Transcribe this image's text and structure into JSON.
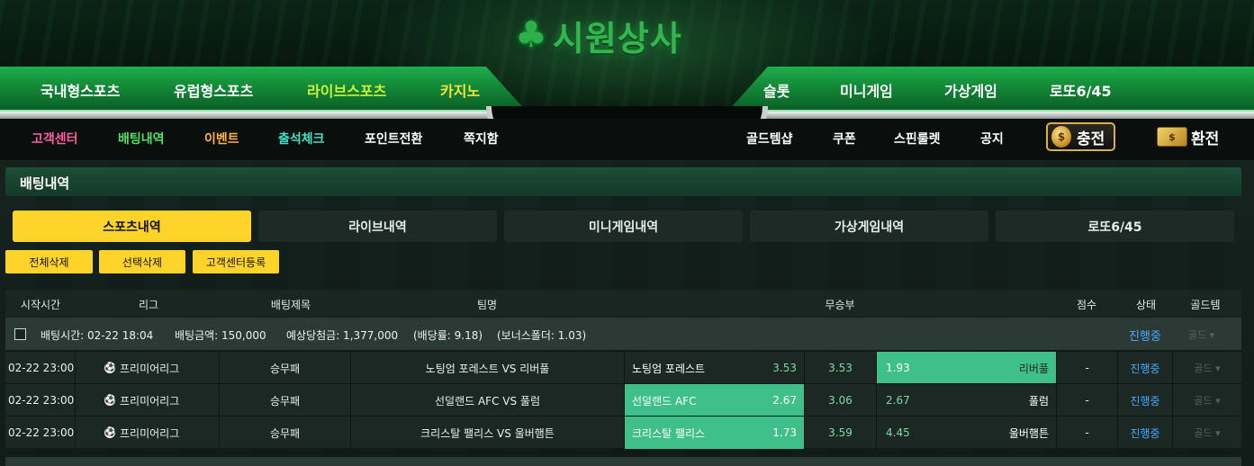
{
  "brand": {
    "logo_text": "시원상사",
    "logo_icon": "clover-icon"
  },
  "nav_main": {
    "left": [
      "국내형스포츠",
      "유럽형스포츠",
      "라이브스포츠",
      "카지노"
    ],
    "right": [
      "슬롯",
      "미니게임",
      "가상게임",
      "로또6/45"
    ]
  },
  "nav_sub": {
    "left": [
      "고객센터",
      "배팅내역",
      "이벤트",
      "출석체크",
      "포인트전환",
      "쪽지함"
    ],
    "right": [
      "골드템샵",
      "쿠폰",
      "스핀룰렛",
      "공지"
    ],
    "charge_label": "충전",
    "exchange_label": "환전"
  },
  "page": {
    "section_title": "배팅내역",
    "tabs": [
      "스포츠내역",
      "라이브내역",
      "미니게임내역",
      "가상게임내역",
      "로또6/45"
    ],
    "actions": [
      "전체삭제",
      "선택삭제",
      "고객센터등록"
    ]
  },
  "table": {
    "headers": [
      "시작시간",
      "리그",
      "배팅제목",
      "팀명",
      "무승부",
      "점수",
      "상태",
      "골드템"
    ],
    "summary": {
      "bet_time": "배팅시간:  02-22 18:04",
      "bet_amount": "배팅금액:  150,000",
      "expected": "예상당첨금:  1,377,000",
      "odds": "(배당률: 9.18)",
      "bonus": "(보너스폴더: 1.03)",
      "status": "진행중",
      "gold": "골드 ▾"
    },
    "rows": [
      {
        "time": "02-22 23:00",
        "league": "프리미어리그",
        "title": "승무패",
        "match": "노팅엄 포레스트 VS 리버풀",
        "home": "노팅엄 포레스트",
        "home_odds": "3.53",
        "draw": "3.53",
        "away_odds": "1.93",
        "away": "리버풀",
        "selected": "away",
        "score": "-",
        "status": "진행중",
        "gold": "골드 ▾"
      },
      {
        "time": "02-22 23:00",
        "league": "프리미어리그",
        "title": "승무패",
        "match": "선덜랜드 AFC VS 풀럼",
        "home": "선덜랜드 AFC",
        "home_odds": "2.67",
        "draw": "3.06",
        "away_odds": "2.67",
        "away": "풀럼",
        "selected": "home",
        "score": "-",
        "status": "진행중",
        "gold": "골드 ▾"
      },
      {
        "time": "02-22 23:00",
        "league": "프리미어리그",
        "title": "승무패",
        "match": "크리스탈 팰리스 VS 울버햄튼",
        "home": "크리스탈 팰리스",
        "home_odds": "1.73",
        "draw": "3.59",
        "away_odds": "4.45",
        "away": "울버햄튼",
        "selected": "home",
        "score": "-",
        "status": "진행중",
        "gold": "골드 ▾"
      }
    ]
  },
  "colors": {
    "accent_yellow": "#ffd42a",
    "selected_green": "#3fbf8a",
    "status_blue": "#4aa8ff",
    "nav_green": "#138a38"
  }
}
